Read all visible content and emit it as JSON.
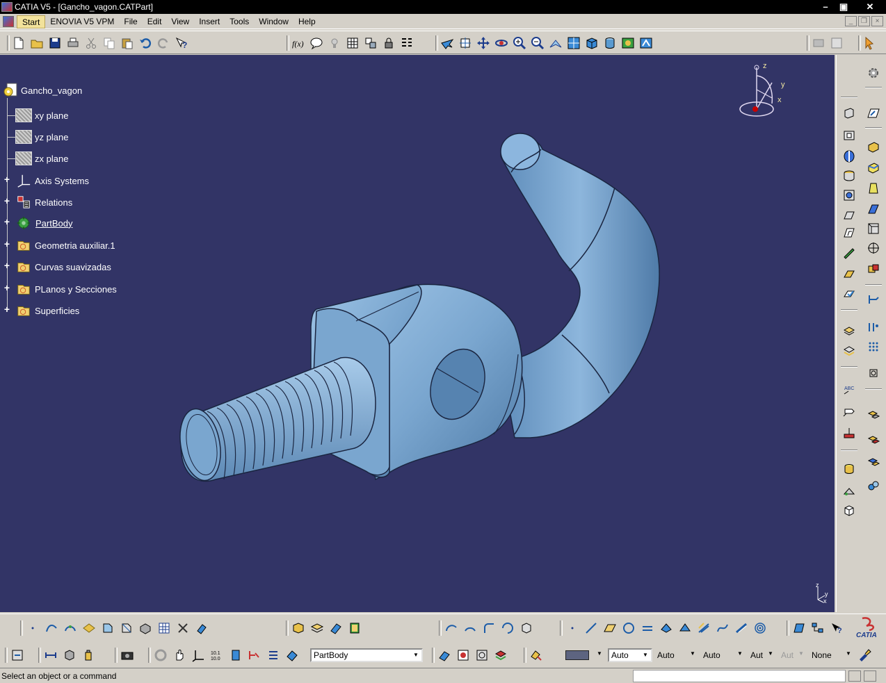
{
  "window": {
    "title": "CATIA V5 - [Gancho_vagon.CATPart]"
  },
  "menubar": {
    "items": [
      "Start",
      "ENOVIA V5 VPM",
      "File",
      "Edit",
      "View",
      "Insert",
      "Tools",
      "Window",
      "Help"
    ]
  },
  "tree": {
    "root": "Gancho_vagon",
    "nodes": [
      {
        "label": "xy plane",
        "icon": "plane-icon"
      },
      {
        "label": "yz plane",
        "icon": "plane-icon"
      },
      {
        "label": "zx plane",
        "icon": "plane-icon"
      },
      {
        "label": "Axis Systems",
        "icon": "axis-icon"
      },
      {
        "label": "Relations",
        "icon": "relations-icon"
      },
      {
        "label": "PartBody",
        "icon": "partbody-icon"
      },
      {
        "label": "Geometria auxiliar.1",
        "icon": "geometrical-set-icon"
      },
      {
        "label": "Curvas suavizadas",
        "icon": "geometrical-set-icon"
      },
      {
        "label": "PLanos y Secciones",
        "icon": "geometrical-set-icon"
      },
      {
        "label": "Superficies",
        "icon": "geometrical-set-icon"
      }
    ]
  },
  "compass": {
    "x": "x",
    "y": "y",
    "z": "z"
  },
  "mini_axis": {
    "z": "z",
    "y": "y",
    "x": "x"
  },
  "bottom_toolbar": {
    "current_body": "PartBody",
    "graphic_props": {
      "color": "",
      "transparency": "Auto",
      "line_thickness": "Auto",
      "line_type": "Auto",
      "point_type": "Aut",
      "rendering": "Aut",
      "layer": "None"
    }
  },
  "logo": {
    "text": "CATIA"
  },
  "status": {
    "message": "Select an object or a command"
  },
  "colors": {
    "viewport": "#323466",
    "part": "#7fa8cf",
    "ui": "#d4d0c8"
  }
}
